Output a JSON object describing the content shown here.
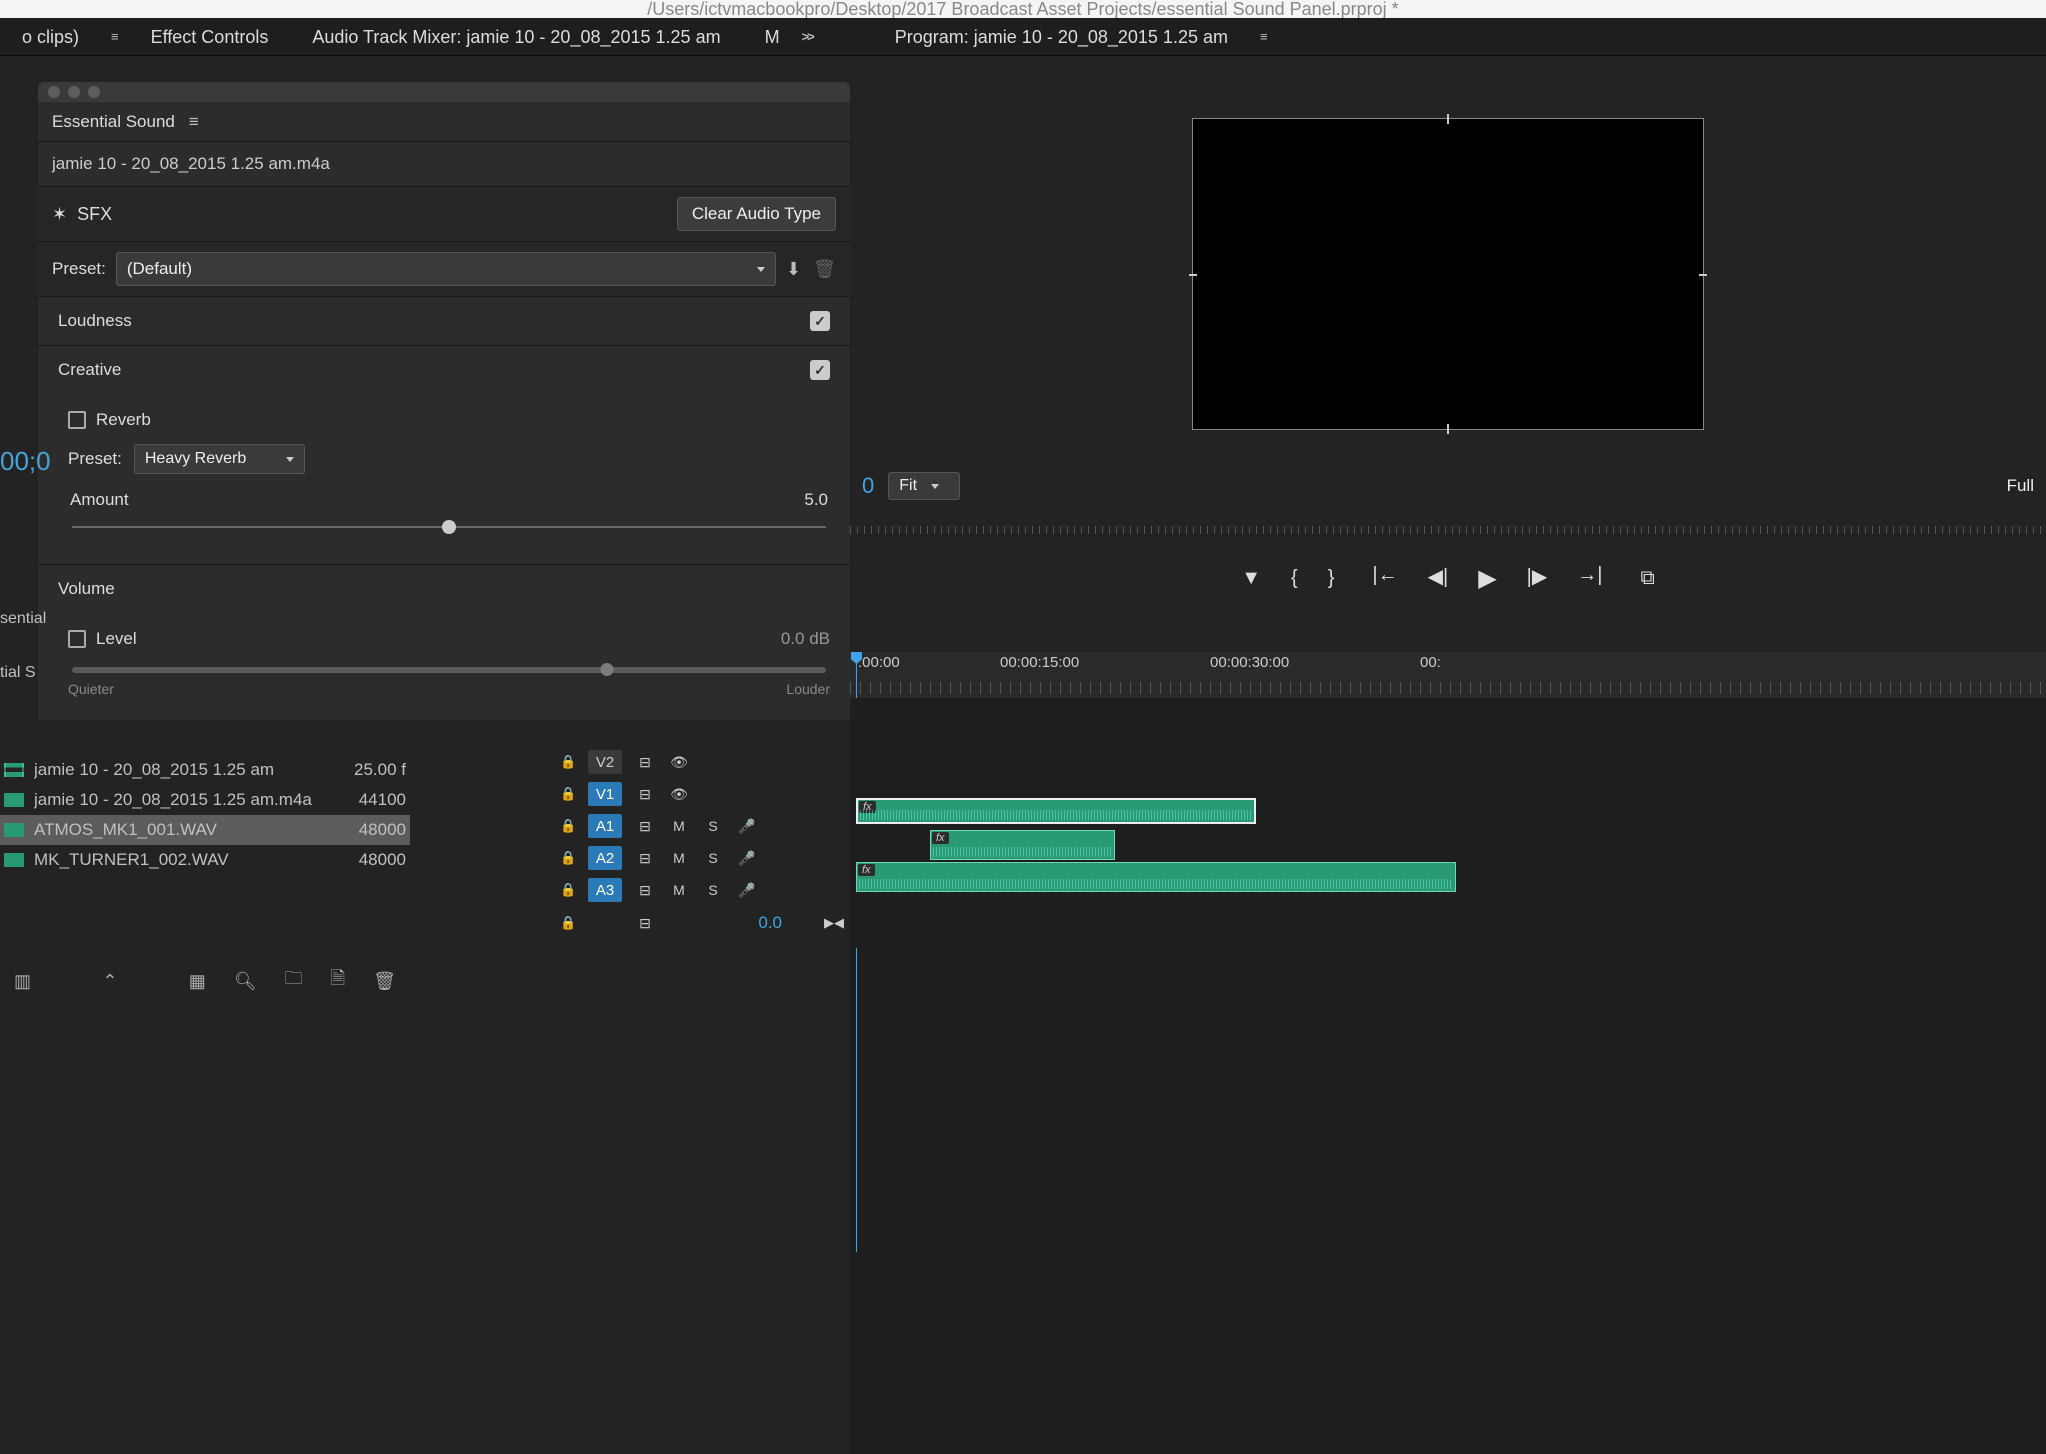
{
  "titlebar": "/Users/ictvmacbookpro/Desktop/2017 Broadcast Asset Projects/essential Sound Panel.prproj *",
  "topTabs": {
    "t0": "o clips)",
    "t1": "Effect Controls",
    "t2": "Audio Track Mixer: jamie 10 - 20_08_2015 1.25 am",
    "t3": "M",
    "program": "Program: jamie 10 - 20_08_2015 1.25 am"
  },
  "es": {
    "title": "Essential Sound",
    "clip": "jamie 10 - 20_08_2015 1.25 am.m4a",
    "sfx": "SFX",
    "clear": "Clear Audio Type",
    "presetLabel": "Preset:",
    "presetValue": "(Default)",
    "loudness": "Loudness",
    "creative": "Creative",
    "reverb": "Reverb",
    "creativePresetLabel": "Preset:",
    "creativePresetValue": "Heavy Reverb",
    "amount": "Amount",
    "amountVal": "5.0",
    "volume": "Volume",
    "level": "Level",
    "levelVal": "0.0 dB",
    "quieter": "Quieter",
    "louder": "Louder"
  },
  "leftFrag": {
    "tc": "00;0",
    "s1": "sential",
    "s2": "tial S"
  },
  "project": {
    "rows": [
      {
        "name": "jamie 10 - 20_08_2015 1.25 am",
        "val": "25.00 f",
        "type": "seq"
      },
      {
        "name": "jamie 10 - 20_08_2015 1.25 am.m4a",
        "val": "44100",
        "type": "aud"
      },
      {
        "name": "ATMOS_MK1_001.WAV",
        "val": "48000",
        "type": "aud",
        "sel": true
      },
      {
        "name": "MK_TURNER1_002.WAV",
        "val": "48000",
        "type": "aud"
      }
    ]
  },
  "tracks": {
    "v2": "V2",
    "v1": "V1",
    "a1": "A1",
    "a2": "A2",
    "a3": "A3",
    "m": "M",
    "s": "S",
    "zero": "0.0"
  },
  "program": {
    "tc": "0",
    "fit": "Fit",
    "full": "Full"
  },
  "ruler": {
    "t0": ":00:00",
    "t1": "00:00:15:00",
    "t2": "00:00:30:00",
    "t3": "00:"
  }
}
